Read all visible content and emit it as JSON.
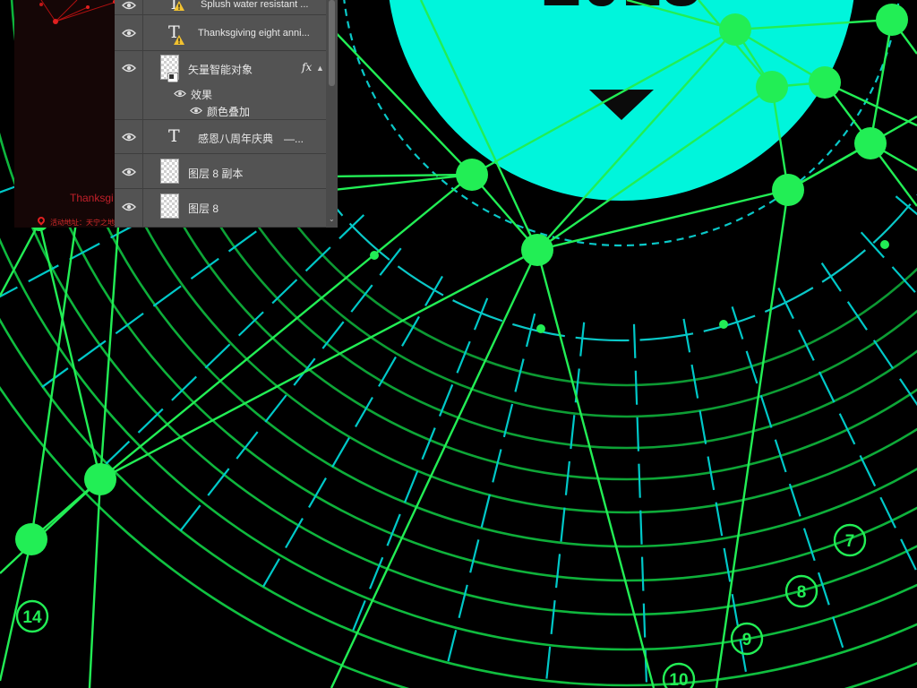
{
  "canvas": {
    "year_partial": "2018",
    "ring_numbers": [
      "7",
      "8",
      "9",
      "10",
      "14"
    ],
    "colors": {
      "background": "#000000",
      "circle": "#00f5dc",
      "network": "#22ee55",
      "rings": "#11cc44",
      "dashes": "#00c8c8"
    }
  },
  "preview": {
    "text": "Thanksgi",
    "address": "活动地址：天宁之地"
  },
  "layers_panel": {
    "layers": [
      {
        "type": "text",
        "label": "Splush water resistant ...",
        "warning": true
      },
      {
        "type": "text",
        "label": "Thanksgiving eight anni...",
        "warning": true
      },
      {
        "type": "smart-object",
        "label": "矢量智能对象",
        "fx": "fx"
      },
      {
        "type": "effect-group",
        "label": "效果"
      },
      {
        "type": "effect",
        "label": "颜色叠加"
      },
      {
        "type": "text",
        "label": "感恩八周年庆典　—..."
      },
      {
        "type": "pixel",
        "label": "图层 8 副本"
      },
      {
        "type": "pixel",
        "label": "图层 8"
      }
    ]
  },
  "icons": {
    "visibility": "eye-icon",
    "text_layer": "text-layer-icon",
    "warning": "warning-icon",
    "effects": "fx-icon"
  }
}
